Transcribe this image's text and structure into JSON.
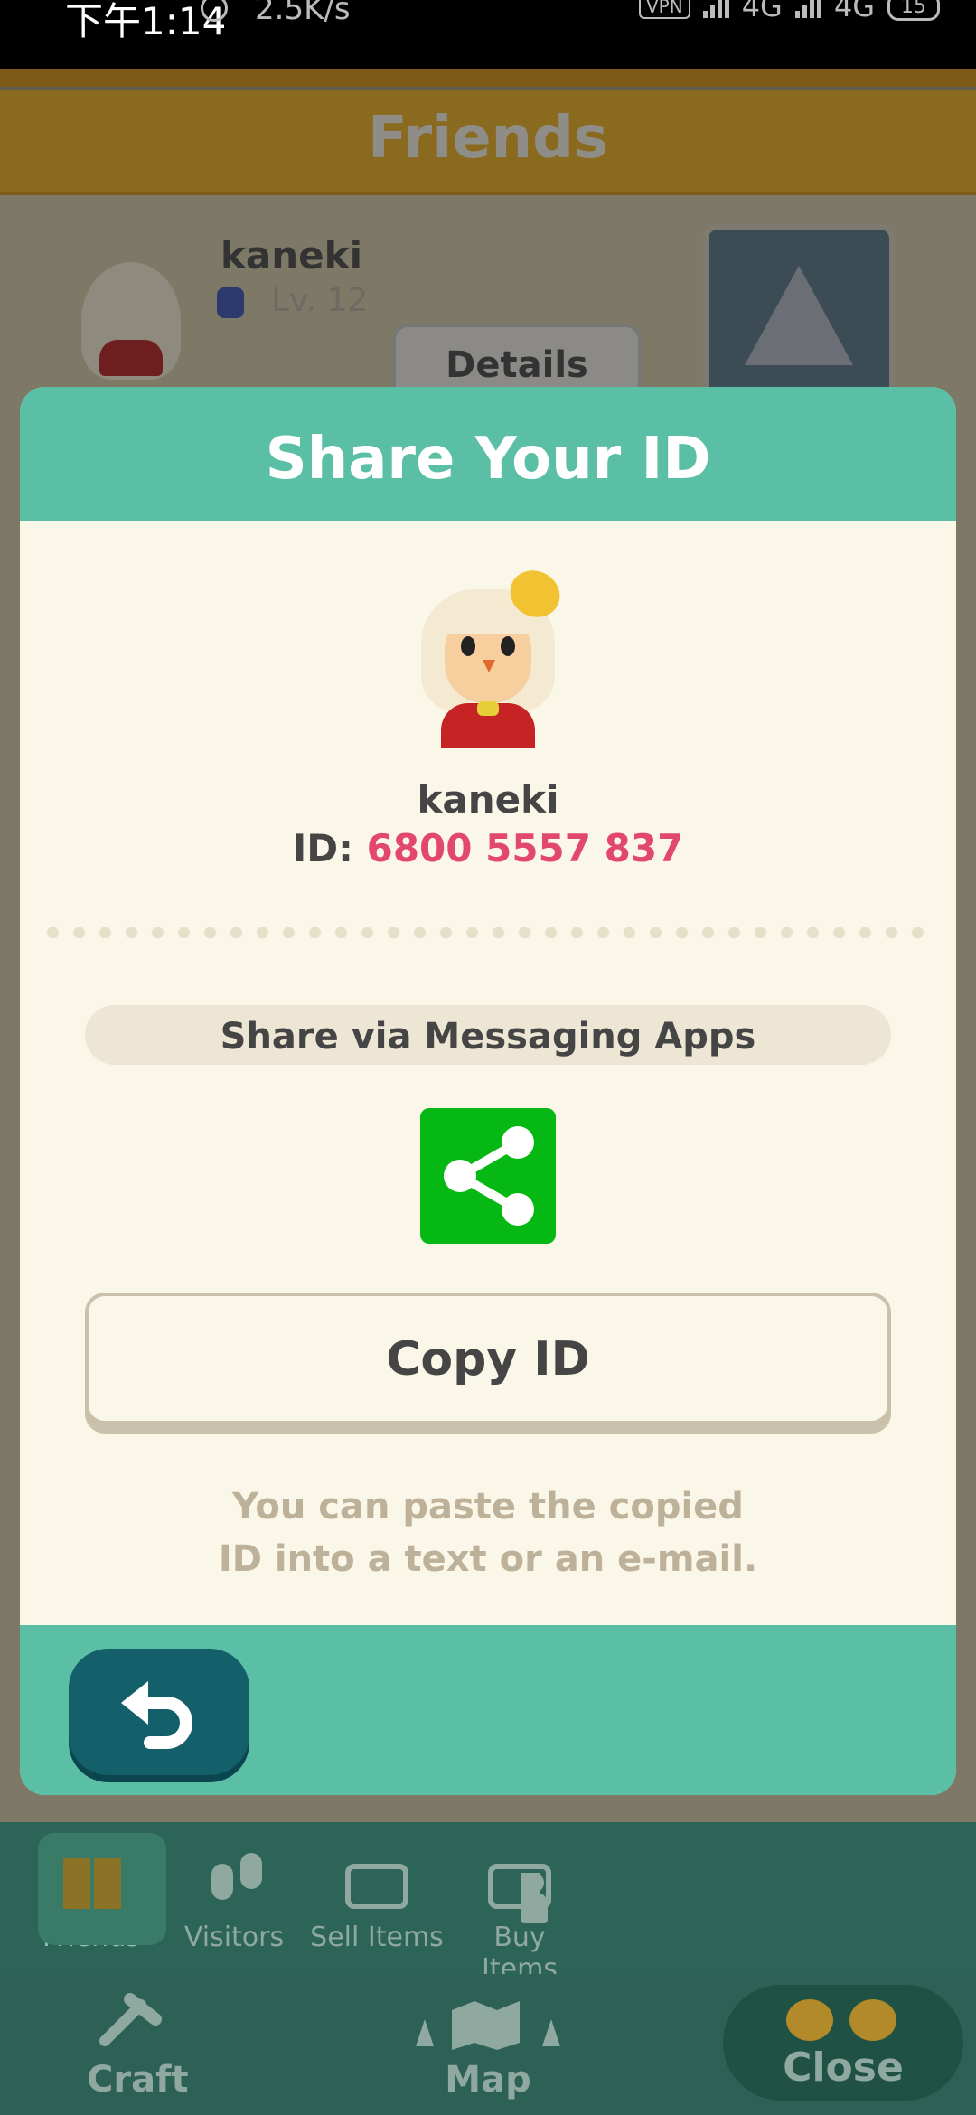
{
  "status_bar": {
    "time": "下午1:14",
    "net_speed": "2.5K/s",
    "vpn": "VPN",
    "net1": "4G",
    "net2": "4G",
    "battery": "15"
  },
  "background": {
    "screen_title": "Friends",
    "player_name": "kaneki",
    "level": "Lv. 12",
    "details_label": "Details"
  },
  "modal": {
    "title": "Share Your ID",
    "player_name": "kaneki",
    "id_label": "ID:",
    "id_value": "6800 5557 837",
    "share_via_label": "Share via Messaging Apps",
    "share_icon": "share-icon",
    "copy_label": "Copy ID",
    "hint_line1": "You can paste the copied",
    "hint_line2": "ID into a text or an e-mail.",
    "back_icon": "back-arrow-icon"
  },
  "nav": {
    "tabs": [
      {
        "label": "Friends",
        "icon": "friends-icon",
        "active": true
      },
      {
        "label": "Visitors",
        "icon": "footprints-icon",
        "active": false
      },
      {
        "label": "Sell Items",
        "icon": "sell-box-icon",
        "active": false
      },
      {
        "label": "Buy Items",
        "icon": "buy-box-icon",
        "active": false
      }
    ],
    "bottom": {
      "craft": "Craft",
      "map": "Map",
      "close": "Close"
    }
  },
  "colors": {
    "accent_teal": "#5bbfa6",
    "id_pink": "#e2486c",
    "share_green": "#06b814",
    "back_button": "#13606a"
  }
}
